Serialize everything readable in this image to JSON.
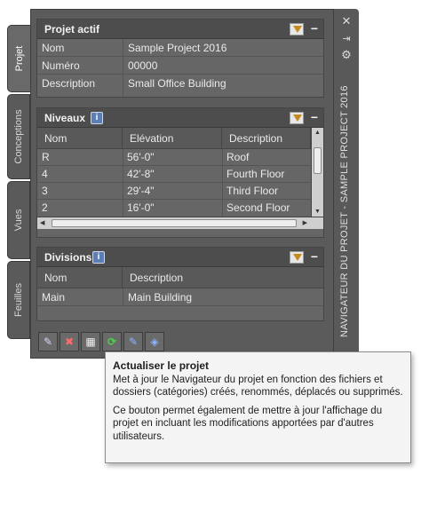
{
  "window": {
    "vertical_title": "NAVIGATEUR DU PROJET - SAMPLE PROJECT 2016",
    "close_icon": "close-icon",
    "pin_icon": "pin-icon",
    "settings_icon": "settings-icon"
  },
  "tabs": [
    {
      "label": "Projet",
      "active": true
    },
    {
      "label": "Conceptions",
      "active": false
    },
    {
      "label": "Vues",
      "active": false
    },
    {
      "label": "Feuilles",
      "active": false
    }
  ],
  "projet_actif": {
    "title": "Projet actif",
    "rows": [
      {
        "key": "Nom",
        "value": "Sample Project 2016"
      },
      {
        "key": "Numéro",
        "value": "00000"
      },
      {
        "key": "Description",
        "value": "Small Office Building"
      }
    ]
  },
  "niveaux": {
    "title": "Niveaux",
    "info": "i",
    "columns": [
      "Nom",
      "Elévation",
      "Description"
    ],
    "rows": [
      [
        "R",
        "56'-0\"",
        "Roof"
      ],
      [
        "4",
        "42'-8\"",
        "Fourth Floor"
      ],
      [
        "3",
        "29'-4\"",
        "Third Floor"
      ],
      [
        "2",
        "16'-0\"",
        "Second Floor"
      ]
    ]
  },
  "divisions": {
    "title": "Divisions",
    "info": "i",
    "columns": [
      "Nom",
      "Description"
    ],
    "rows": [
      [
        "Main",
        "Main Building"
      ]
    ]
  },
  "toolbar": {
    "buttons": [
      "new-project-icon",
      "close-project-icon",
      "project-properties-icon",
      "refresh-project-icon",
      "repath-project-icon",
      "settings-project-icon"
    ]
  },
  "tooltip": {
    "title": "Actualiser le projet",
    "p1": "Met à jour le Navigateur du projet en fonction des fichiers et dossiers (catégories) créés, renommés, déplacés ou supprimés.",
    "p2": "Ce bouton permet également de mettre à jour l'affichage du projet en incluant les modifications apportées par d'autres utilisateurs."
  }
}
